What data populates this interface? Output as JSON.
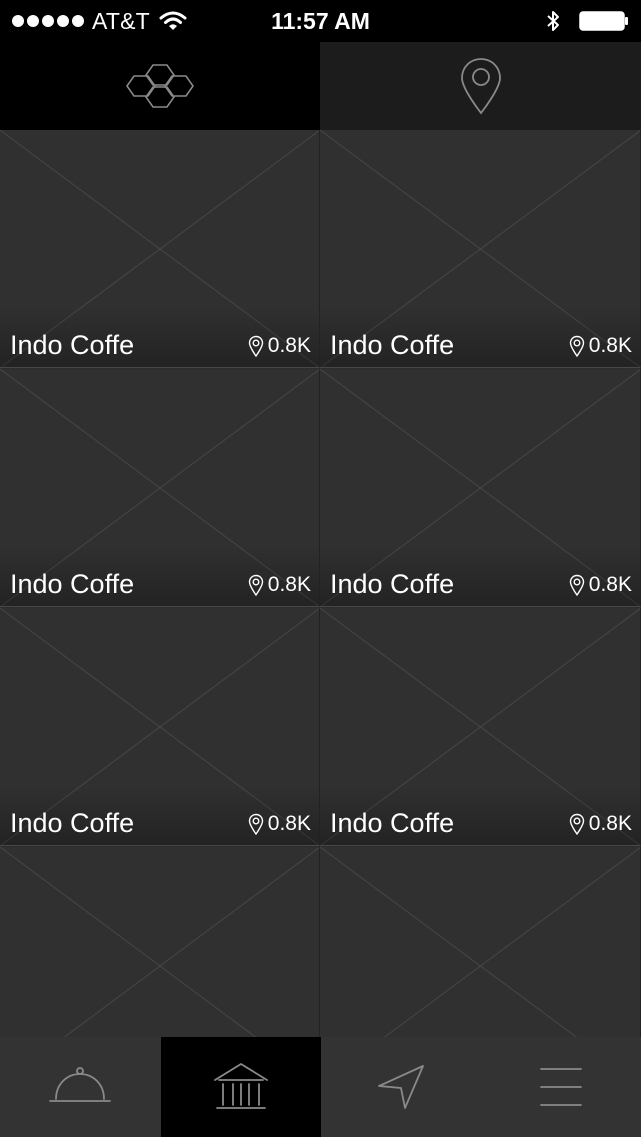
{
  "status_bar": {
    "carrier": "AT&T",
    "time": "11:57 AM",
    "signal_dots": 5
  },
  "top_tabs": [
    {
      "icon": "hexagon-grid-icon",
      "active": true
    },
    {
      "icon": "map-pin-icon",
      "active": false
    }
  ],
  "places": [
    {
      "name": "Indo Coffe",
      "distance": "0.8K"
    },
    {
      "name": "Indo Coffe",
      "distance": "0.8K"
    },
    {
      "name": "Indo Coffe",
      "distance": "0.8K"
    },
    {
      "name": "Indo Coffe",
      "distance": "0.8K"
    },
    {
      "name": "Indo Coffe",
      "distance": "0.8K"
    },
    {
      "name": "Indo Coffe",
      "distance": "0.8K"
    },
    {
      "name": "",
      "distance": ""
    },
    {
      "name": "",
      "distance": ""
    }
  ],
  "bottom_tabs": [
    {
      "icon": "cloche-icon",
      "active": false
    },
    {
      "icon": "bank-icon",
      "active": true
    },
    {
      "icon": "navigation-arrow-icon",
      "active": false
    },
    {
      "icon": "menu-icon",
      "active": false
    }
  ],
  "colors": {
    "background": "#2d2d2d",
    "card": "#303030",
    "active_tab": "#000000",
    "icon_stroke": "#8a8a8a"
  }
}
